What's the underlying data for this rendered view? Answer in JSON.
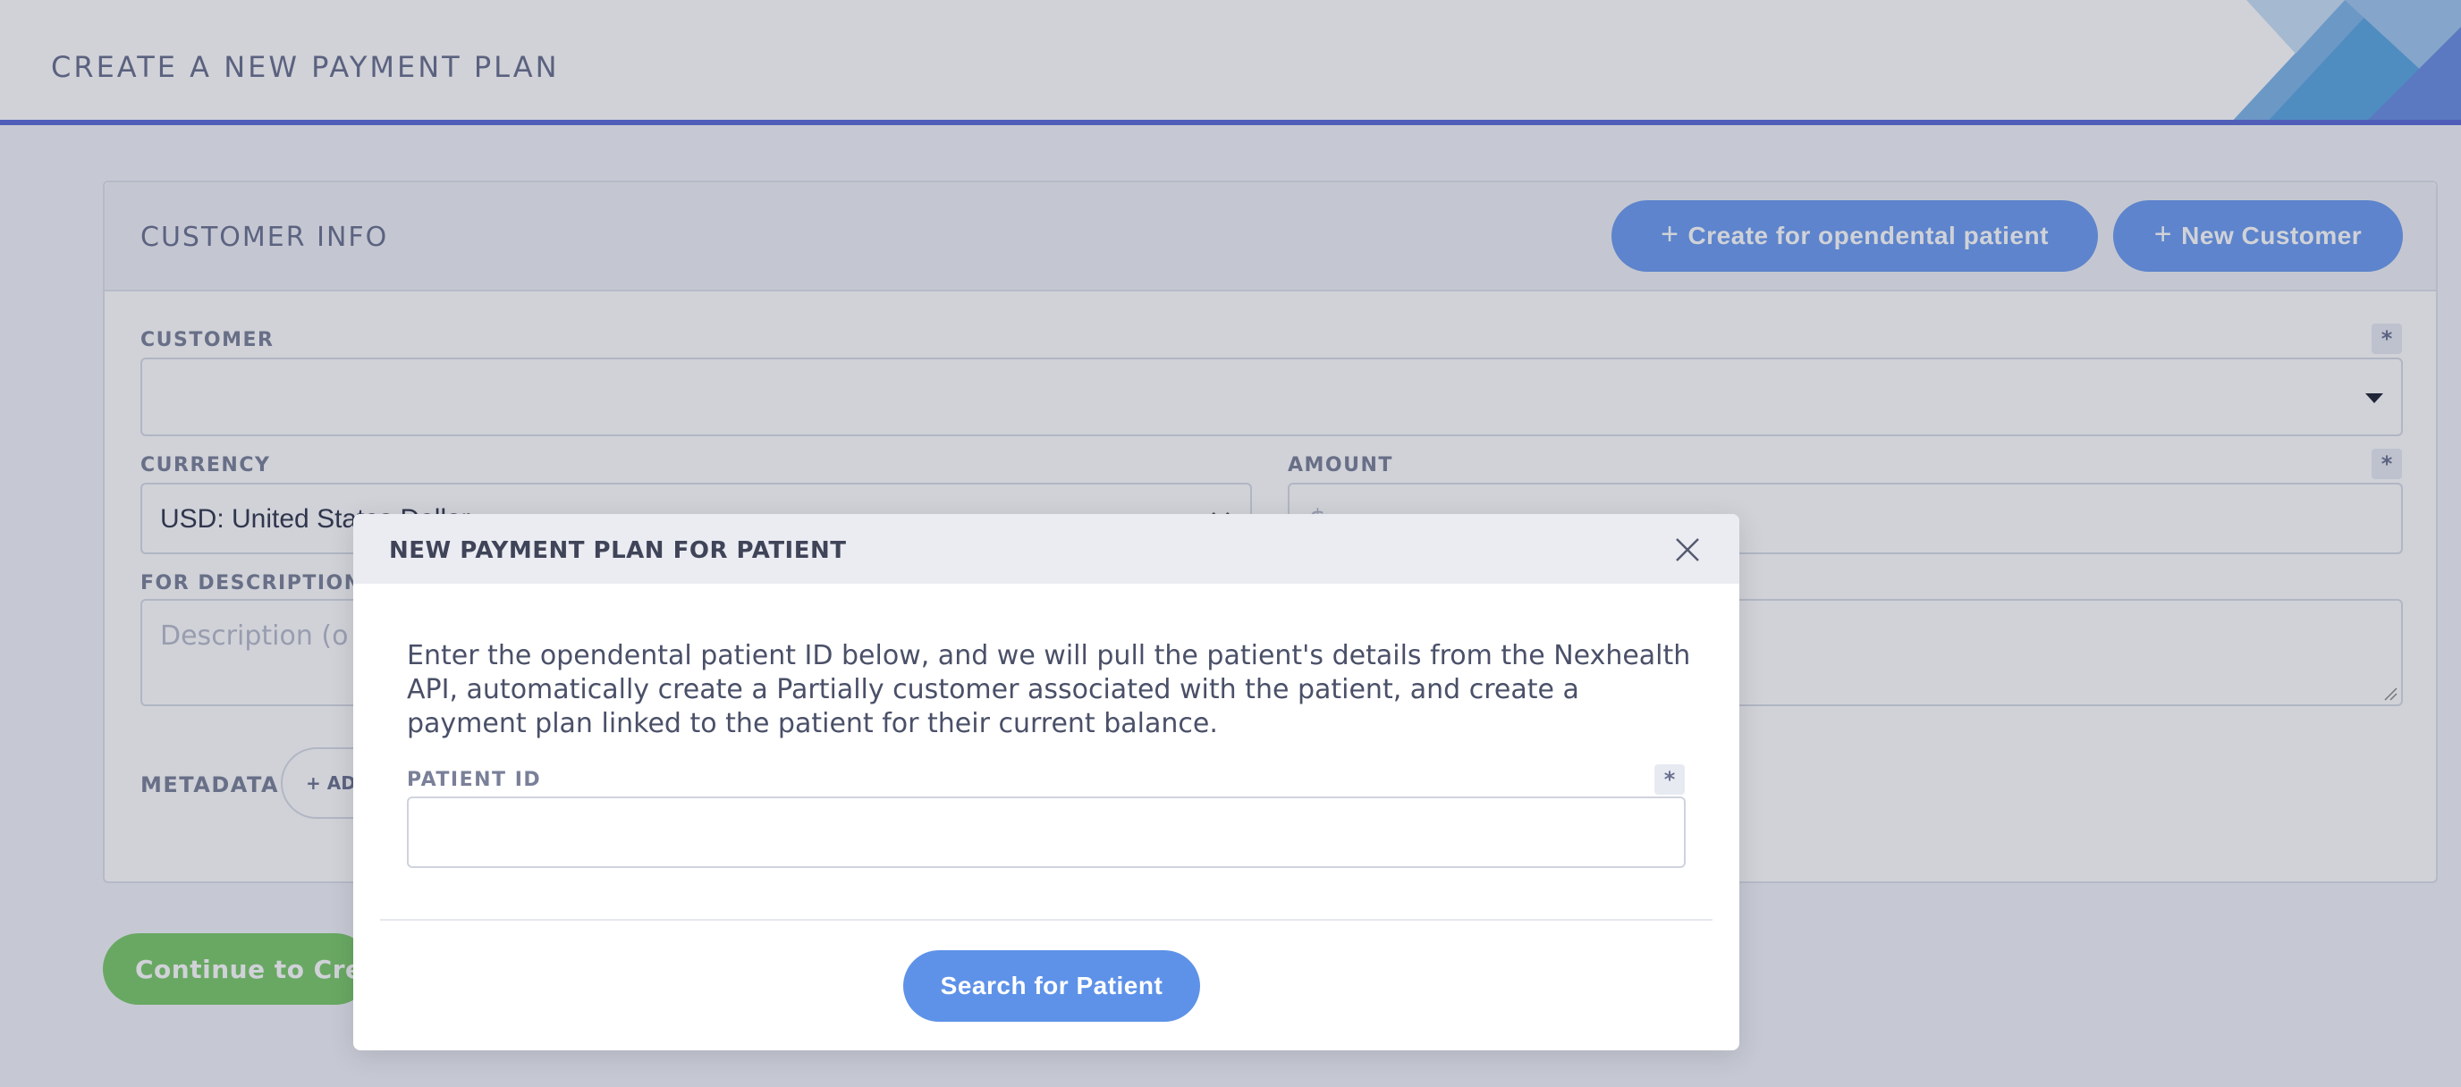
{
  "header": {
    "title": "CREATE A NEW PAYMENT PLAN"
  },
  "card": {
    "title": "CUSTOMER INFO",
    "create_opendental_label": "Create for opendental patient",
    "new_customer_label": "New Customer",
    "customer": {
      "label": "CUSTOMER",
      "value": ""
    },
    "currency": {
      "label": "CURRENCY",
      "value": "USD: United States Dollar"
    },
    "amount": {
      "label": "AMOUNT",
      "prefix": "$"
    },
    "description": {
      "label": "FOR DESCRIPTION",
      "placeholder": "Description (o"
    },
    "metadata": {
      "label": "METADATA",
      "add_label": "+ ADD METADATA"
    },
    "required_mark": "*"
  },
  "continue_label": "Continue to Create",
  "modal": {
    "title": "NEW PAYMENT PLAN FOR PATIENT",
    "description": "Enter the opendental patient ID below, and we will pull the patient's details from the Nexhealth API, automatically create a Partially customer associated with the patient, and create a payment plan linked to the patient for their current balance.",
    "patient_id": {
      "label": "PATIENT ID",
      "value": ""
    },
    "required_mark": "*",
    "search_label": "Search for Patient"
  },
  "colors": {
    "accent": "#5c6bd6",
    "primary_button": "#6c9cf0",
    "success_button": "#7cc96a"
  },
  "icons": {
    "close": "close-icon",
    "plus": "plus-icon",
    "dropdown": "caret-down-icon"
  }
}
